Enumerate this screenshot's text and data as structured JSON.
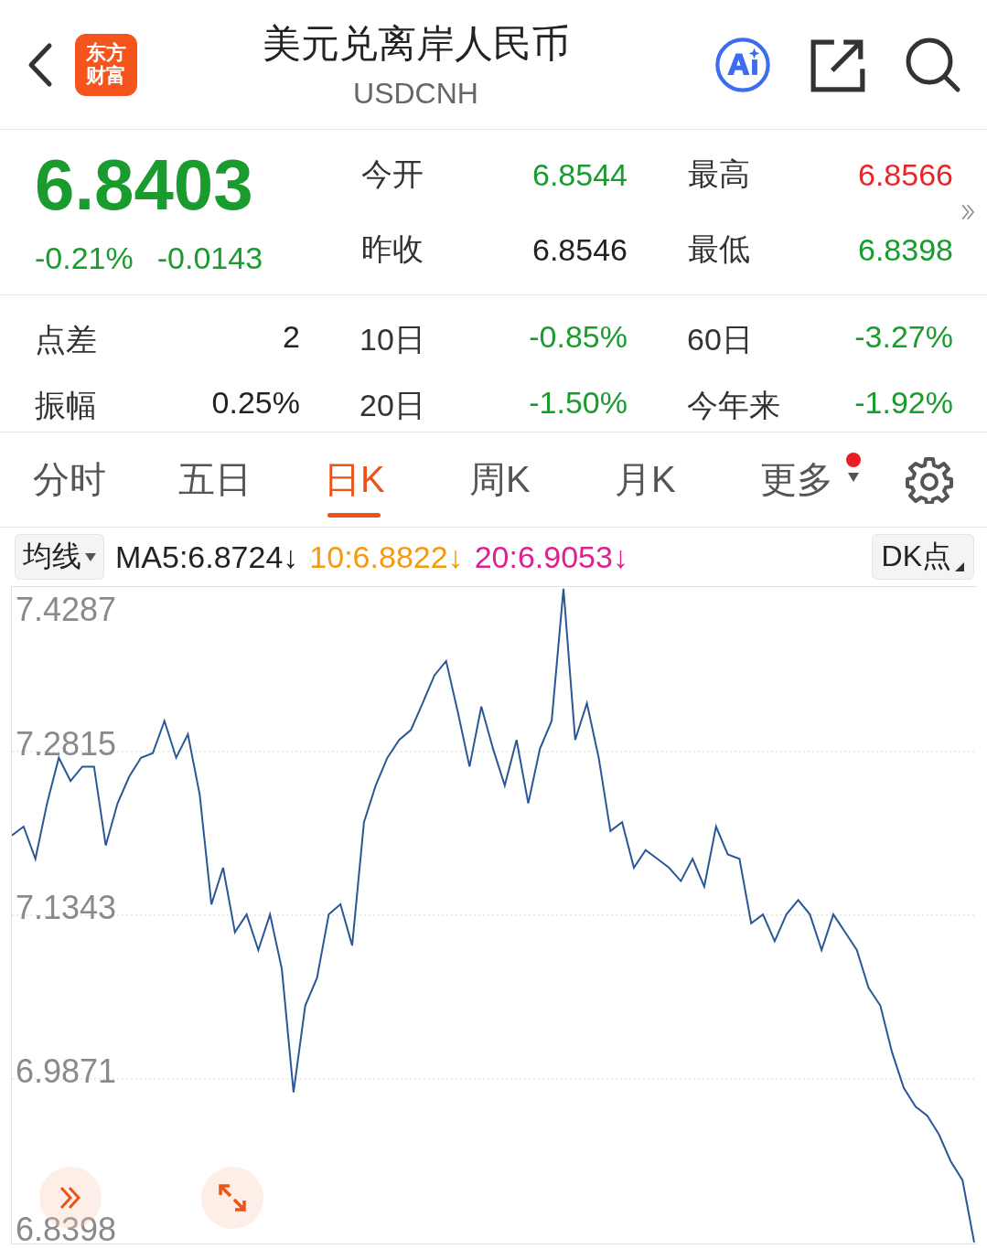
{
  "header": {
    "logo": [
      "东方",
      "财富"
    ],
    "title": "美元兑离岸人民币",
    "subtitle": "USDCNH"
  },
  "quote": {
    "price": "6.8403",
    "change_pct": "-0.21%",
    "change": "-0.0143",
    "color": "#1a9b2e",
    "fields": [
      {
        "label": "今开",
        "value": "6.8544",
        "color": "#1a9b2e"
      },
      {
        "label": "最高",
        "value": "6.8566",
        "color": "#e8262a"
      },
      {
        "label": "昨收",
        "value": "6.8546",
        "color": "#222222"
      },
      {
        "label": "最低",
        "value": "6.8398",
        "color": "#1a9b2e"
      }
    ]
  },
  "stats": [
    {
      "label": "点差",
      "value": "2",
      "color": "#222222"
    },
    {
      "label": "10日",
      "value": "-0.85%",
      "color": "#1a9b2e"
    },
    {
      "label": "60日",
      "value": "-3.27%",
      "color": "#1a9b2e"
    },
    {
      "label": "振幅",
      "value": "0.25%",
      "color": "#222222"
    },
    {
      "label": "20日",
      "value": "-1.50%",
      "color": "#1a9b2e"
    },
    {
      "label": "今年来",
      "value": "-1.92%",
      "color": "#1a9b2e"
    }
  ],
  "tabs": [
    {
      "label": "分时",
      "selected": false
    },
    {
      "label": "五日",
      "selected": false
    },
    {
      "label": "日K",
      "selected": true
    },
    {
      "label": "周K",
      "selected": false
    },
    {
      "label": "月K",
      "selected": false
    },
    {
      "label": "更多",
      "selected": false,
      "badge": true,
      "menu": true
    }
  ],
  "indicator_bar": {
    "dropdown": "均线",
    "averages": [
      {
        "text": "MA5:6.8724↓",
        "color": "#222222"
      },
      {
        "text": "10:6.8822↓",
        "color": "#f59a0c"
      },
      {
        "text": "20:6.9053↓",
        "color": "#dd1f8f"
      }
    ],
    "button": "DK点"
  },
  "chart": {
    "chart_data": {
      "type": "line",
      "grid": true,
      "ylim": [
        6.8398,
        7.4287
      ],
      "yticks": [
        {
          "value": 7.4287,
          "label": "7.4287"
        },
        {
          "value": 7.2815,
          "label": "7.2815"
        },
        {
          "value": 7.1343,
          "label": "7.1343"
        },
        {
          "value": 6.9871,
          "label": "6.9871"
        },
        {
          "value": 6.8398,
          "label": "6.8398"
        }
      ],
      "series": [
        {
          "color": "#2b5797",
          "values": [
            7.206,
            7.214,
            7.185,
            7.235,
            7.276,
            7.255,
            7.268,
            7.268,
            7.197,
            7.235,
            7.259,
            7.276,
            7.28,
            7.309,
            7.276,
            7.297,
            7.243,
            7.144,
            7.177,
            7.119,
            7.135,
            7.103,
            7.135,
            7.086,
            6.975,
            7.053,
            7.078,
            7.135,
            7.144,
            7.107,
            7.218,
            7.251,
            7.276,
            7.292,
            7.301,
            7.325,
            7.35,
            7.363,
            7.317,
            7.268,
            7.322,
            7.284,
            7.251,
            7.292,
            7.235,
            7.284,
            7.309,
            7.428,
            7.292,
            7.325,
            7.276,
            7.21,
            7.218,
            7.177,
            7.193,
            7.185,
            7.177,
            7.165,
            7.185,
            7.16,
            7.214,
            7.189,
            7.185,
            7.127,
            7.135,
            7.111,
            7.135,
            7.148,
            7.135,
            7.103,
            7.135,
            7.119,
            7.103,
            7.069,
            7.053,
            7.011,
            6.979,
            6.962,
            6.954,
            6.937,
            6.913,
            6.896,
            6.84
          ]
        }
      ]
    }
  }
}
